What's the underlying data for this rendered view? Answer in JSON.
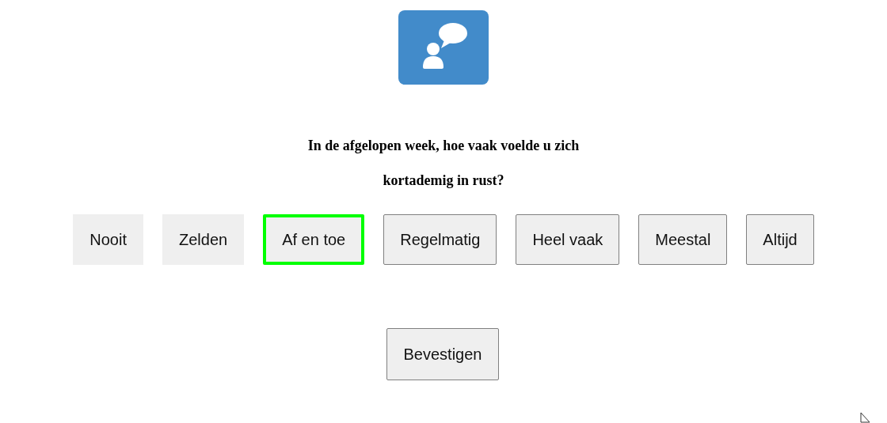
{
  "question": {
    "lines": [
      "In de afgelopen week, hoe vaak voelde u zich",
      "kortademig in rust?"
    ]
  },
  "options": [
    {
      "label": "Nooit",
      "bordered": false,
      "selected": false
    },
    {
      "label": "Zelden",
      "bordered": false,
      "selected": false
    },
    {
      "label": "Af en toe",
      "bordered": true,
      "selected": true
    },
    {
      "label": "Regelmatig",
      "bordered": true,
      "selected": false
    },
    {
      "label": "Heel vaak",
      "bordered": true,
      "selected": false
    },
    {
      "label": "Meestal",
      "bordered": true,
      "selected": false
    },
    {
      "label": "Altijd",
      "bordered": true,
      "selected": false
    }
  ],
  "confirm_button": {
    "label": "Bevestigen"
  }
}
